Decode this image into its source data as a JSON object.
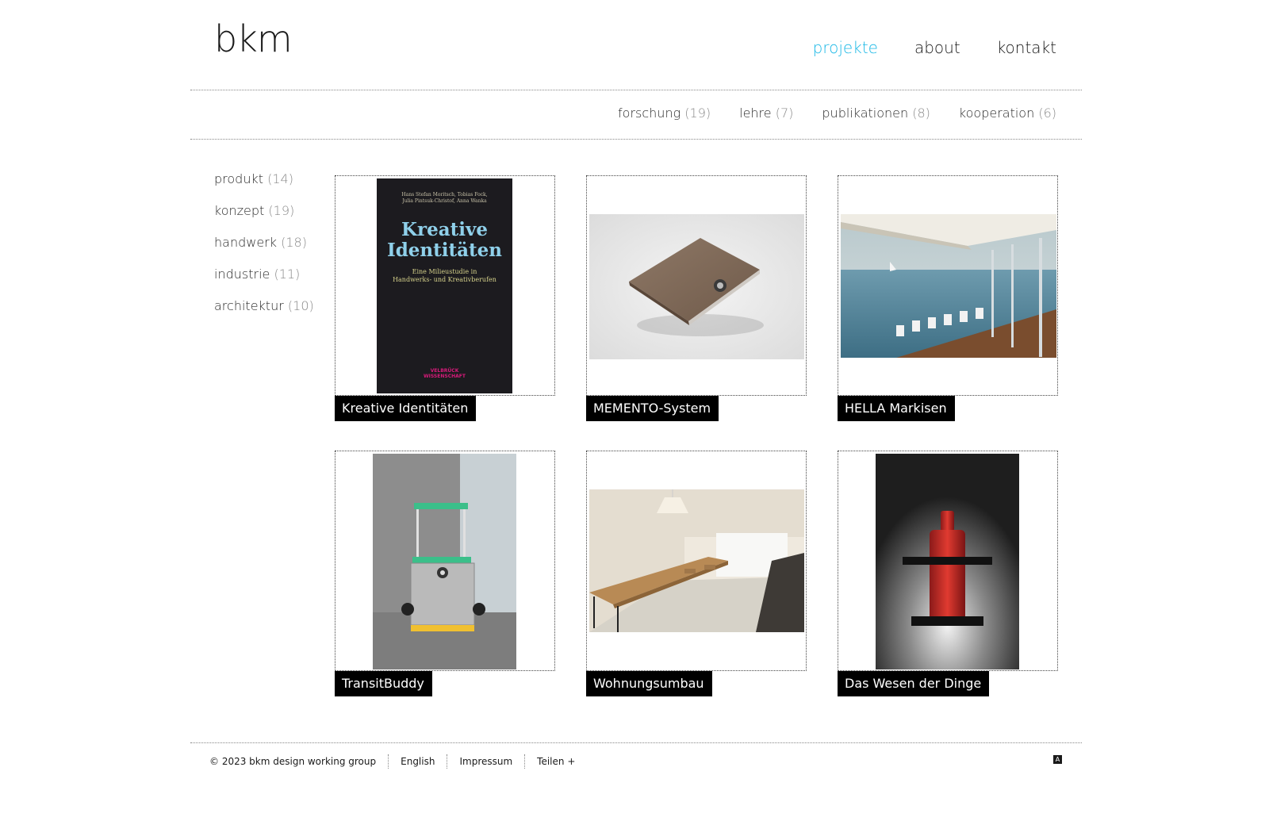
{
  "logo": {
    "text": "bkm"
  },
  "mainnav": [
    {
      "label": "projekte",
      "active": true
    },
    {
      "label": "about",
      "active": false
    },
    {
      "label": "kontakt",
      "active": false
    }
  ],
  "subnav": [
    {
      "label": "forschung",
      "count": "(19)"
    },
    {
      "label": "lehre",
      "count": "(7)"
    },
    {
      "label": "publikationen",
      "count": "(8)"
    },
    {
      "label": "kooperation",
      "count": "(6)"
    }
  ],
  "categories": [
    {
      "label": "produkt",
      "count": "(14)"
    },
    {
      "label": "konzept",
      "count": "(19)"
    },
    {
      "label": "handwerk",
      "count": "(18)"
    },
    {
      "label": "industrie",
      "count": "(11)"
    },
    {
      "label": "architektur",
      "count": "(10)"
    }
  ],
  "projects": [
    {
      "title": "Kreative Identitäten",
      "book": {
        "authors_line1": "Hans Stefan Moritsch, Tobias Fock,",
        "authors_line2": "Julia Pintsuk-Christof, Anna Wanka",
        "title_line1": "Kreative",
        "title_line2": "Identitäten",
        "subtitle_line1": "Eine Milieustudie in",
        "subtitle_line2": "Handwerks- und Kreativberufen",
        "publisher_line1": "VELBRÜCK",
        "publisher_line2": "WISSENSCHAFT"
      }
    },
    {
      "title": "MEMENTO-System"
    },
    {
      "title": "HELLA Markisen"
    },
    {
      "title": "TransitBuddy"
    },
    {
      "title": "Wohnungsumbau"
    },
    {
      "title": "Das Wesen der Dinge"
    }
  ],
  "footer": {
    "copyright": "© 2023 bkm design working group",
    "language": "English",
    "impressum": "Impressum",
    "share": "Teilen +",
    "icon_label": "A"
  },
  "colors": {
    "accent": "#1ab8e6",
    "caption_bg": "#000000"
  }
}
